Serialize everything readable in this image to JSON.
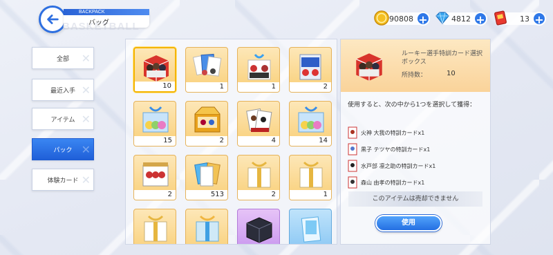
{
  "header": {
    "section_en": "BACKPACK",
    "title": "バッグ",
    "ghost": "BASKETBALL"
  },
  "currencies": [
    {
      "name": "coin",
      "icon": "gold-coin-icon",
      "value": "90808"
    },
    {
      "name": "gem",
      "icon": "blue-gem-icon",
      "value": "4812"
    },
    {
      "name": "ticket",
      "icon": "red-ticket-icon",
      "value": "13"
    }
  ],
  "menu": [
    {
      "label": "全部",
      "active": false
    },
    {
      "label": "最近入手",
      "active": false
    },
    {
      "label": "アイテム",
      "active": false
    },
    {
      "label": "パック",
      "active": true
    },
    {
      "label": "体験カード",
      "active": false
    }
  ],
  "items": [
    {
      "count": "10",
      "kind": "card-selection-box-icon",
      "selected": true
    },
    {
      "count": "1",
      "kind": "card-pack-icon"
    },
    {
      "count": "1",
      "kind": "gift-box-blue-ribbon-icon"
    },
    {
      "count": "2",
      "kind": "card-pack-blue-icon"
    },
    {
      "count": "15",
      "kind": "rainbow-gift-box-icon"
    },
    {
      "count": "2",
      "kind": "gold-card-box-icon"
    },
    {
      "count": "4",
      "kind": "character-card-pack-icon"
    },
    {
      "count": "14",
      "kind": "rainbow-gift-box-icon"
    },
    {
      "count": "2",
      "kind": "character-card-box-icon"
    },
    {
      "count": "513",
      "kind": "card-bundle-icon"
    },
    {
      "count": "2",
      "kind": "gold-ribbon-gift-icon"
    },
    {
      "count": "1",
      "kind": "gold-ribbon-gift-icon"
    },
    {
      "count": "",
      "kind": "gold-ribbon-gift-icon"
    },
    {
      "count": "",
      "kind": "blue-ribbon-gift-icon"
    },
    {
      "count": "",
      "kind": "dark-chest-icon"
    },
    {
      "count": "",
      "kind": "ice-card-pack-icon"
    }
  ],
  "detail": {
    "name": "ルーキー選手特訓カード選択ボックス",
    "own_label": "所持数：",
    "own_value": "10",
    "description": "使用すると、次の中から1つを選択して獲得：",
    "rewards": [
      "火神 大我の特訓カードx1",
      "黒子 テツヤの特訓カードx1",
      "水戸部 凛之助の特訓カードx1",
      "森山 由孝の特訓カードx1"
    ],
    "notice": "このアイテムは売却できません",
    "use_label": "使用"
  }
}
